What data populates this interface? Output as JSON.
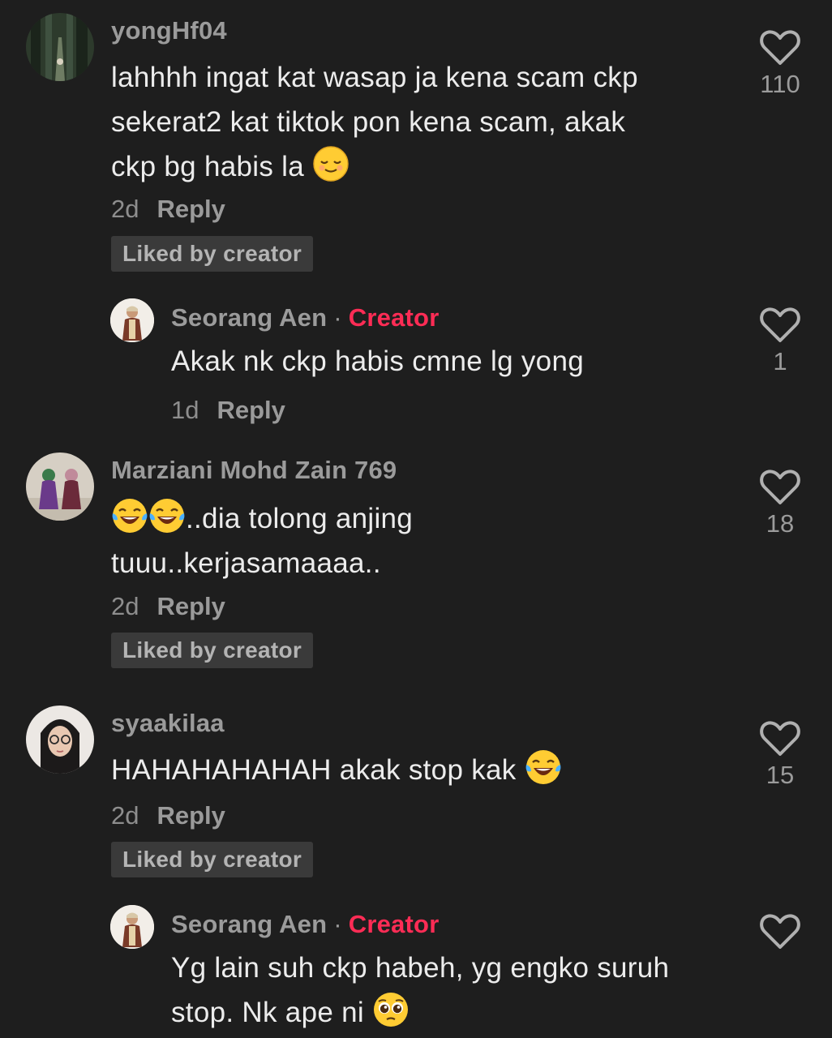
{
  "comments": [
    {
      "username": "yongHf04",
      "lines": [
        "lahhhh ingat kat wasap ja kena scam ckp",
        "sekerat2 kat tiktok pon kena scam, akak",
        "ckp bg habis la"
      ],
      "emoji": "relieved-face",
      "age": "2d",
      "reply_label": "Reply",
      "badge": "Liked by creator",
      "likes": "110"
    },
    {
      "username": "Seorang Aen",
      "separator": "·",
      "role": "Creator",
      "lines": [
        "Akak nk ckp habis cmne lg yong"
      ],
      "age": "1d",
      "reply_label": "Reply",
      "likes": "1"
    },
    {
      "username": "Marziani Mohd Zain 769",
      "lines": [
        "..dia tolong anjing",
        "tuuu..kerjasamaaaa.."
      ],
      "emoji": "tears-of-joy",
      "age": "2d",
      "reply_label": "Reply",
      "badge": "Liked by creator",
      "likes": "18"
    },
    {
      "username": "syaakilaa",
      "lines": [
        "HAHAHAHAHAH akak stop kak"
      ],
      "emoji": "tears-of-joy",
      "age": "2d",
      "reply_label": "Reply",
      "badge": "Liked by creator",
      "likes": "15"
    },
    {
      "username": "Seorang Aen",
      "separator": "·",
      "role": "Creator",
      "lines": [
        "Yg lain suh ckp habeh, yg engko suruh",
        "stop. Nk ape ni"
      ],
      "emoji": "pleading-face",
      "likes": ""
    }
  ],
  "colors": {
    "background": "#1e1e1e",
    "creator_accent": "#fe2c55",
    "badge_bg": "#3a3a3a"
  }
}
